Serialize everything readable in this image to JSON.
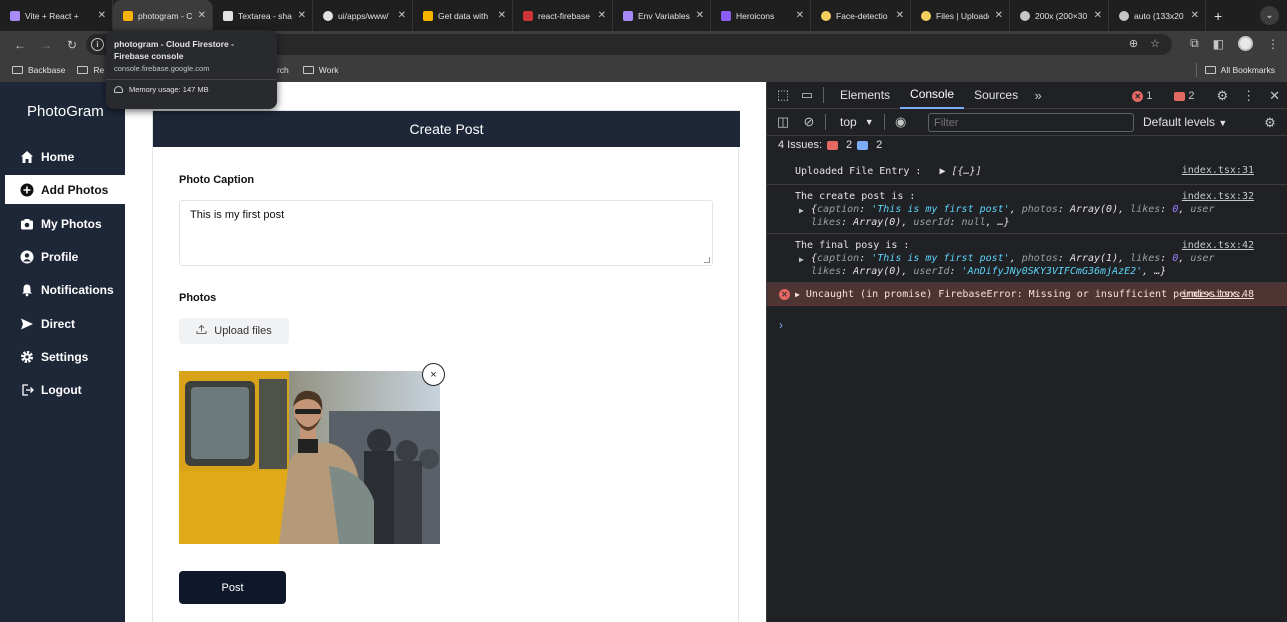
{
  "tabs": [
    {
      "label": "Vite + React +",
      "color": "#a78bfa"
    },
    {
      "label": "photogram - C",
      "color": "#f5b400",
      "active": true
    },
    {
      "label": "Textarea - sha",
      "color": "#e3e3e3"
    },
    {
      "label": "ui/apps/www/",
      "color": "#e3e3e3"
    },
    {
      "label": "Get data with",
      "color": "#f5b400"
    },
    {
      "label": "react-firebase",
      "color": "#cc3534"
    },
    {
      "label": "Env Variables",
      "color": "#a78bfa"
    },
    {
      "label": "Heroicons",
      "color": "#8b5cf6"
    },
    {
      "label": "Face-detectio",
      "color": "#f5d060"
    },
    {
      "label": "Files | Uploadc",
      "color": "#f5d060"
    },
    {
      "label": "200x (200×30",
      "color": "#c4c7c5"
    },
    {
      "label": "auto (133x20",
      "color": "#c4c7c5"
    }
  ],
  "tooltip": {
    "title": "photogram - Cloud Firestore - Firebase console",
    "url": "console.firebase.google.com",
    "memory": "Memory usage: 147 MB"
  },
  "bookmarks": {
    "items": [
      "Backbase",
      "Re",
      "arch",
      "Work"
    ],
    "all": "All Bookmarks"
  },
  "app": {
    "brand": "PhotoGram",
    "nav": [
      {
        "label": "Home",
        "icon": "home-icon"
      },
      {
        "label": "Add Photos",
        "icon": "plus-circle-icon",
        "active": true
      },
      {
        "label": "My Photos",
        "icon": "camera-icon"
      },
      {
        "label": "Profile",
        "icon": "user-icon"
      },
      {
        "label": "Notifications",
        "icon": "bell-icon"
      },
      {
        "label": "Direct",
        "icon": "send-icon"
      },
      {
        "label": "Settings",
        "icon": "gear-icon"
      },
      {
        "label": "Logout",
        "icon": "logout-icon"
      }
    ],
    "card_title": "Create Post",
    "caption_label": "Photo Caption",
    "caption_value": "This is my first post",
    "photos_label": "Photos",
    "upload_label": "Upload files",
    "remove_label": "×",
    "post_label": "Post"
  },
  "devtools": {
    "tabs": [
      "Elements",
      "Console",
      "Sources"
    ],
    "active_tab": "Console",
    "error_count": "1",
    "message_count": "2",
    "context": "top",
    "filter_placeholder": "Filter",
    "levels": "Default levels",
    "issues_label": "4 Issues:",
    "issues_red": "2",
    "issues_blue": "2",
    "logs": [
      {
        "text": "Uploaded File Entry :",
        "obj": "[{…}]",
        "src": "index.tsx:31"
      },
      {
        "text": "The create post is :",
        "src": "index.tsx:32"
      },
      {
        "text": "The final posy is  :",
        "src": "index.tsx:42"
      },
      {
        "text": "Uncaught (in promise) FirebaseError: Missing or insufficient permissions.",
        "src": "index.tsx:48"
      }
    ],
    "obj1": {
      "caption": "'This is my first post'",
      "photos": "Array(0)",
      "likes": "0",
      "likes2": "Array(0)",
      "userId": "null"
    },
    "obj2": {
      "caption": "'This is my first post'",
      "photos": "Array(1)",
      "likes": "0",
      "likes2": "Array(0)",
      "userId": "'AnDifyJNy0SKY3VIFCmG36mjAzE2'"
    }
  }
}
